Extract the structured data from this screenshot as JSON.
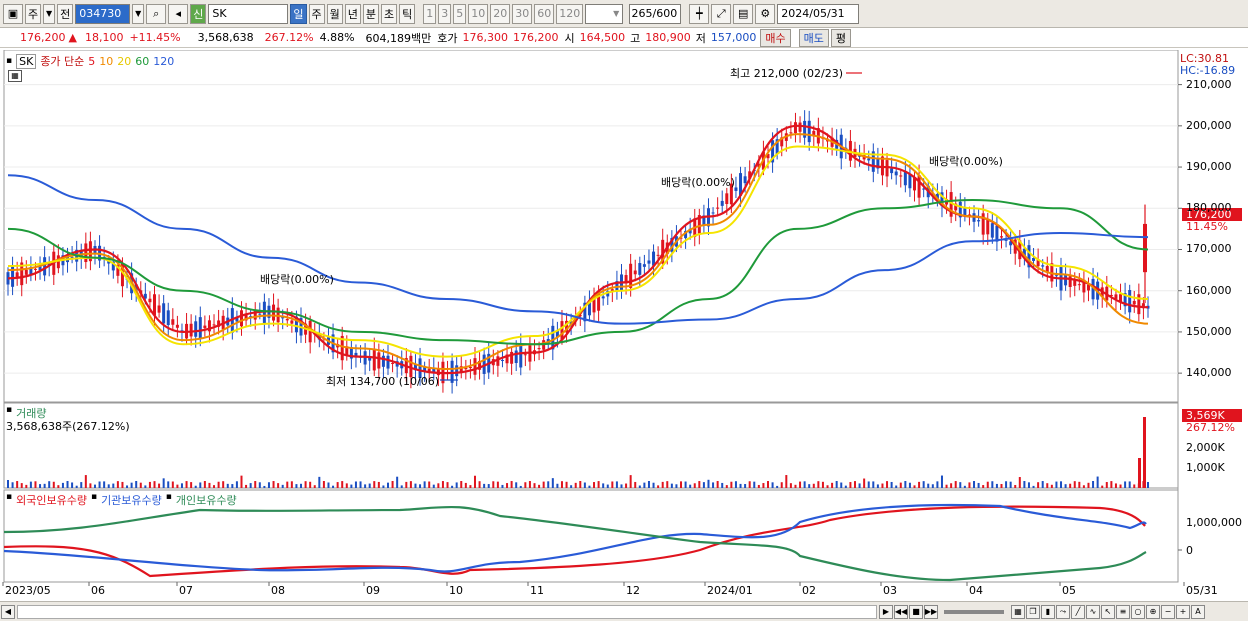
{
  "toolbar": {
    "period_main": "주",
    "period_prev": "전",
    "code": "034730",
    "credit_badge": "신",
    "stock_name": "SK",
    "periods": [
      "일",
      "주",
      "월",
      "년",
      "분",
      "초",
      "틱"
    ],
    "numbers": [
      "1",
      "3",
      "5",
      "10",
      "20",
      "30",
      "60",
      "120"
    ],
    "count": "265",
    "count_total": "/600",
    "date": "2024/05/31"
  },
  "quote": {
    "price": "176,200",
    "arrow": "▲",
    "change": "18,100",
    "change_pct": "+11.45%",
    "volume": "3,568,638",
    "volume_pct": "267.12%",
    "turnover": "4.88%",
    "amount": "604,189백만",
    "ask_label": "호가",
    "ask": "176,300",
    "bid": "176,200",
    "open_label": "시",
    "open": "164,500",
    "high_label": "고",
    "high": "180,900",
    "low_label": "저",
    "low": "157,000",
    "buy": "매수",
    "sell": "매도",
    "eval": "평"
  },
  "price_panel": {
    "stock_tag": "SK",
    "ma_label": "종가 단순",
    "ma_periods": [
      {
        "label": "5",
        "color": "#e0141e"
      },
      {
        "label": "10",
        "color": "#f08a00"
      },
      {
        "label": "20",
        "color": "#f5e400"
      },
      {
        "label": "60",
        "color": "#1f9a3a"
      },
      {
        "label": "120",
        "color": "#2a5bd7"
      }
    ],
    "lc": "LC:30.81",
    "hc": "HC:-16.89",
    "current_tag": "176,200",
    "current_pct": "11.45%",
    "annotations": {
      "high": "최고 212,000 (02/23)",
      "low": "최저 134,700 (10/06)",
      "div1": "배당락(0.00%)",
      "div2": "배당락(0.00%)",
      "div3": "배당락(0.00%)"
    },
    "y_ticks": [
      "210,000",
      "200,000",
      "190,000",
      "180,000",
      "170,000",
      "160,000",
      "150,000",
      "140,000"
    ]
  },
  "volume_panel": {
    "title": "거래량",
    "value": "3,568,638주(267.12%)",
    "tag": "3,569K",
    "tag_pct": "267.12%",
    "y_ticks": [
      "2,000K",
      "1,000K"
    ]
  },
  "holding_panel": {
    "legend": [
      {
        "label": "외국인보유수량",
        "color": "#e0141e"
      },
      {
        "label": "기관보유수량",
        "color": "#2a5bd7"
      },
      {
        "label": "개인보유수량",
        "color": "#2e8b57"
      }
    ],
    "y_ticks": [
      "1,000,000",
      "0"
    ]
  },
  "x_axis": [
    "2023/05",
    "06",
    "07",
    "08",
    "09",
    "10",
    "11",
    "12",
    "2024/01",
    "02",
    "03",
    "04",
    "05",
    "05/31"
  ],
  "chart_data": {
    "type": "line",
    "x": [
      "2023/05",
      "06",
      "07",
      "08",
      "09",
      "10",
      "11",
      "12",
      "2024/01",
      "02",
      "03",
      "04",
      "05",
      "05/31"
    ],
    "series": [
      {
        "name": "5",
        "values": [
          163000,
          170000,
          150000,
          155000,
          144000,
          140000,
          145000,
          162000,
          178000,
          200000,
          190000,
          178000,
          163000,
          156000
        ]
      },
      {
        "name": "10",
        "values": [
          165000,
          169000,
          148000,
          154000,
          146000,
          141000,
          147000,
          161000,
          176000,
          198000,
          192000,
          178000,
          164000,
          152000
        ]
      },
      {
        "name": "20",
        "values": [
          166000,
          168000,
          147000,
          152000,
          148000,
          144000,
          149000,
          160000,
          174000,
          195000,
          193000,
          180000,
          166000,
          158000
        ]
      },
      {
        "name": "60",
        "values": [
          175000,
          168000,
          160000,
          155000,
          150000,
          148000,
          147000,
          150000,
          158000,
          175000,
          180000,
          182000,
          180000,
          170000
        ]
      },
      {
        "name": "120",
        "values": [
          188000,
          182000,
          175000,
          168000,
          162000,
          158000,
          155000,
          152000,
          153000,
          158000,
          165000,
          172000,
          174000,
          173000
        ]
      }
    ],
    "ylim": [
      133000,
      215000
    ],
    "high": {
      "label": "212,000",
      "date": "02/23"
    },
    "low": {
      "label": "134,700",
      "date": "10/06"
    },
    "last": 176200
  }
}
